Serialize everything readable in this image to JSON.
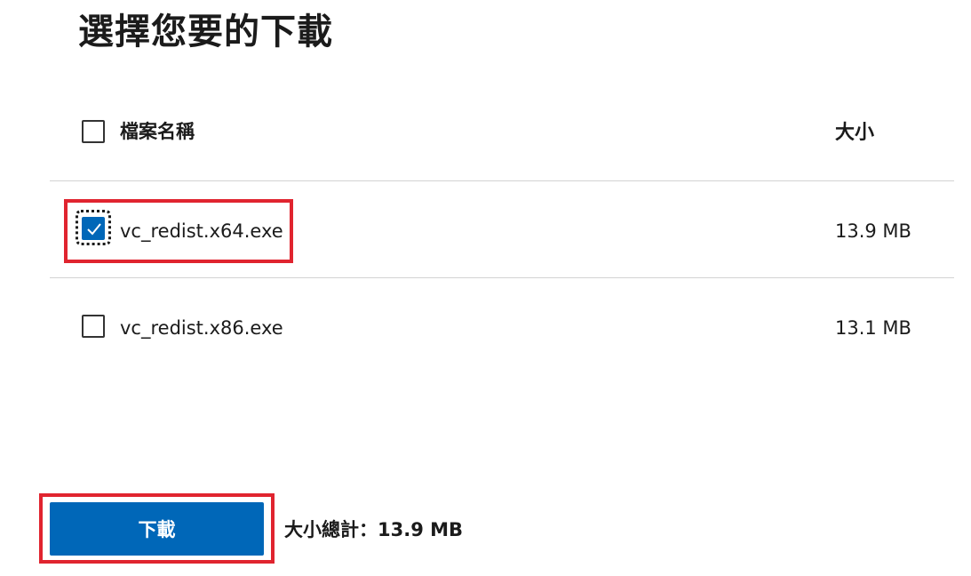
{
  "page_title": "選擇您要的下載",
  "table": {
    "header": {
      "select_all_checked": false,
      "name_label": "檔案名稱",
      "size_label": "大小"
    },
    "rows": [
      {
        "file_name": "vc_redist.x64.exe",
        "size": "13.9 MB",
        "checked": true
      },
      {
        "file_name": "vc_redist.x86.exe",
        "size": "13.1 MB",
        "checked": false
      }
    ]
  },
  "footer": {
    "download_label": "下載",
    "total_label": "大小總計：13.9 MB"
  },
  "colors": {
    "accent": "#0067b8",
    "highlight": "#e0242f",
    "divider": "#d2d2d2"
  }
}
